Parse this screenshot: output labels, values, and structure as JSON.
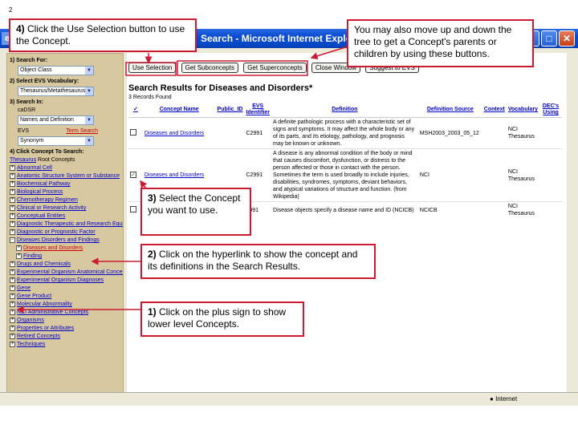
{
  "corner_mark": "2",
  "window": {
    "title": "Search - Microsoft Internet Explor",
    "app_icon": "e",
    "controls": {
      "minimize": "_",
      "maximize": "□",
      "close": "✕"
    },
    "status_zone": "Internet"
  },
  "sidebar": {
    "search_for_label": "1) Search For:",
    "search_for_value": "Object Class",
    "vocab_label": "2) Select EVS Vocabulary:",
    "vocab_value": "Thesaurus/Metathesaurus",
    "search_in_label": "3) Search In:",
    "source_cadsr": "caDSR",
    "names_value": "Names and Definition",
    "source_evs": "EVS",
    "term_search": "Term Search",
    "synonym_value": "Synonym",
    "click_concept_label": "4) Click Concept To Search:",
    "thesaurus_link": "Thesaurus",
    "root_concepts": " Root Concepts",
    "tree": [
      {
        "label": "Abnormal Cell",
        "expander": "+"
      },
      {
        "label": "Anatomic Structure System or Substance",
        "expander": "+"
      },
      {
        "label": "Biochemical Pathway",
        "expander": "+"
      },
      {
        "label": "Biological Process",
        "expander": "+"
      },
      {
        "label": "Chemotherapy Regimen",
        "expander": "+"
      },
      {
        "label": "Clinical or Research Activity",
        "expander": "+"
      },
      {
        "label": "Conceptual Entities",
        "expander": "+"
      },
      {
        "label": "Diagnostic Therapeutic and Research Equipment",
        "expander": "+"
      },
      {
        "label": "Diagnostic or Prognostic Factor",
        "expander": "+"
      },
      {
        "label": "Diseases Disorders and Findings",
        "expander": "-"
      },
      {
        "label": "Diseases and Disorders",
        "expander": "+",
        "child": true,
        "selected": true
      },
      {
        "label": "Finding",
        "expander": "+",
        "child": true
      },
      {
        "label": "Drugs and Chemicals",
        "expander": "+"
      },
      {
        "label": "Experimental Organism Anatomical Concepts",
        "expander": "+"
      },
      {
        "label": "Experimental Organism Diagnoses",
        "expander": "+"
      },
      {
        "label": "Gene",
        "expander": "+"
      },
      {
        "label": "Gene Product",
        "expander": "+"
      },
      {
        "label": "Molecular Abnormality",
        "expander": "+"
      },
      {
        "label": "NCI Administrative Concepts",
        "expander": "+"
      },
      {
        "label": "Organisms",
        "expander": "+"
      },
      {
        "label": "Properties or Attributes",
        "expander": "+"
      },
      {
        "label": "Retired Concepts",
        "expander": "+"
      },
      {
        "label": "Techniques",
        "expander": "+"
      }
    ]
  },
  "toolbar": {
    "use_selection": "Use Selection",
    "get_subconcepts": "Get Subconcepts",
    "get_superconcepts": "Get Superconcepts",
    "close_window": "Close Window",
    "suggest_to_evs": "Suggest to EVS"
  },
  "results": {
    "title": "Search Results for Diseases and Disorders*",
    "count_text": "3 Records Found",
    "columns": [
      "✓",
      "Concept Name",
      "Public_ID",
      "EVS Identifier",
      "Definition",
      "Definition Source",
      "Context",
      "Vocabulary",
      "DEC's Using"
    ],
    "rows": [
      {
        "checked": false,
        "name": "Diseases and Disorders",
        "public_id": "",
        "evs_id": "C2991",
        "definition": "A definite pathologic process with a characteristic set of signs and symptoms. It may affect the whole body or any of its parts, and its etiology, pathology, and prognosis may be known or unknown.",
        "source": "MSH2003_2003_05_12",
        "context": "",
        "vocabulary": "NCI Thesaurus",
        "decs": ""
      },
      {
        "checked": true,
        "name": "Diseases and Disorders",
        "public_id": "",
        "evs_id": "C2991",
        "definition": "A disease is any abnormal condition of the body or mind that causes discomfort, dysfunction, or distress to the person affected or those in contact with the person. Sometimes the term is used broadly to include injuries, disabilities, syndromes, symptoms, deviant behaviors, and atypical variations of structure and function. (from Wikipedia)",
        "source": "NCI",
        "context": "",
        "vocabulary": "NCI Thesaurus",
        "decs": ""
      },
      {
        "checked": false,
        "name": "",
        "public_id": "",
        "evs_id": "2991",
        "definition": "Disease objects specify a disease name and ID (NCICB)",
        "source": "NCICB",
        "context": "",
        "vocabulary": "NCI Thesaurus",
        "decs": ""
      }
    ]
  },
  "callouts": {
    "step4_num": "4)",
    "step4_text": " Click the Use Selection button to use the Concept.",
    "move_tree_text": "You may also move up and down the tree to get a Concept's parents or children by using these buttons.",
    "step3_num": "3)",
    "step3_text": " Select the Concept you want to use.",
    "step2_num": "2)",
    "step2_text": " Click on the hyperlink to show the concept and its definitions in the Search Results.",
    "step1_num": "1)",
    "step1_text": " Click on the plus sign to show lower level Concepts."
  },
  "colors": {
    "callout_border": "#cc1a33",
    "titlebar": "#0a4bd0",
    "sidebar": "#D8C8A0",
    "link": "#0000cc"
  }
}
